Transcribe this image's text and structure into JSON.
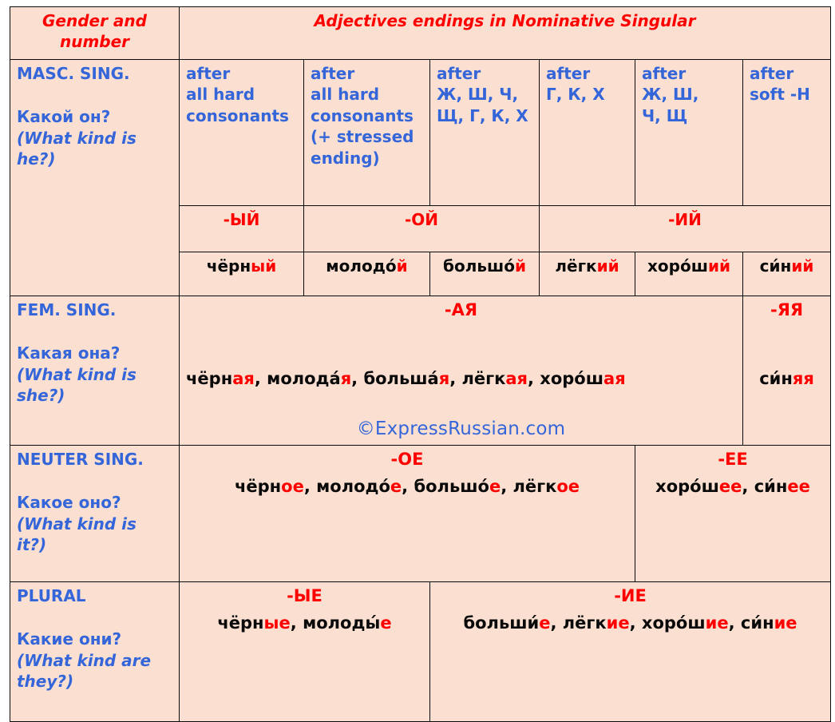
{
  "table": {
    "header": {
      "col1": "Gender and number",
      "col1_line1": "Gender and",
      "col1_line2": "number",
      "span": "Adjectives endings in Nominative Singular"
    },
    "colors": {
      "background": "#fbe0d2",
      "border": "#0a0a0a",
      "red": "#ff0000",
      "blue": "#3465d9",
      "black": "#0a0a0a"
    },
    "watermark": "©ExpressRussian.com",
    "rows": [
      {
        "id": "masculine",
        "gender_title": "MASC. SING.",
        "question": "Какой он?",
        "translation": "(What kind is he?)",
        "translation_line1": "(What kind is",
        "translation_line2": "he?)",
        "conditions": [
          {
            "l1": "after",
            "l2": "all hard",
            "l3": "consonants",
            "l4": "",
            "l5": ""
          },
          {
            "l1": "after",
            "l2": "all hard",
            "l3": "consonants",
            "l4": "(+ stressed",
            "l5": "ending)"
          },
          {
            "l1": "after",
            "l2": "Ж, Ш, Ч,",
            "l3": "Щ, Г, К, Х",
            "l4": "",
            "l5": ""
          },
          {
            "l1": "after",
            "l2": "Г, К, Х",
            "l3": "",
            "l4": "",
            "l5": ""
          },
          {
            "l1": "after",
            "l2": "Ж, Ш,",
            "l3": "Ч, Щ",
            "l4": "",
            "l5": ""
          },
          {
            "l1": "after",
            "l2": "soft -Н",
            "l3": "",
            "l4": "",
            "l5": ""
          }
        ],
        "endings": [
          {
            "label": "-ЫЙ",
            "span": 1
          },
          {
            "label": "-ОЙ",
            "span": 2
          },
          {
            "label": "-ИЙ",
            "span": 3
          }
        ],
        "examples": [
          {
            "stem": "чёрн",
            "end": "ый"
          },
          {
            "stem": "молодо́",
            "end": "й"
          },
          {
            "stem": "большо́",
            "end": "й"
          },
          {
            "stem": "лёгк",
            "end": "ий"
          },
          {
            "stem": "хоро́ш",
            "end": "ий"
          },
          {
            "stem": "си́н",
            "end": "ий"
          }
        ]
      },
      {
        "id": "feminine",
        "gender_title": "FEM. SING.",
        "question": "Какая она?",
        "translation": "(What kind is she?)",
        "translation_line1": "(What kind is",
        "translation_line2": "she?)",
        "main_ending": "-АЯ",
        "main_examples": [
          {
            "stem": "чёрн",
            "end": "ая"
          },
          {
            "stem": "молода́",
            "end": "я"
          },
          {
            "stem": "больша́",
            "end": "я"
          },
          {
            "stem": "лёгк",
            "end": "ая"
          },
          {
            "stem": "хоро́ш",
            "end": "ая"
          }
        ],
        "soft_ending": "-ЯЯ",
        "soft_examples": [
          {
            "stem": "си́н",
            "end": "яя"
          }
        ]
      },
      {
        "id": "neuter",
        "gender_title": "NEUTER SING.",
        "question": "Какое оно?",
        "translation": "(What kind is it?)",
        "translation_line1": "(What kind is",
        "translation_line2": "it?)",
        "main_ending": "-ОЕ",
        "main_examples": [
          {
            "stem": "чёрн",
            "end": "ое"
          },
          {
            "stem": "молодо́",
            "end": "е"
          },
          {
            "stem": "большо́",
            "end": "е"
          },
          {
            "stem": "лёгк",
            "end": "ое"
          }
        ],
        "soft_ending": "-ЕЕ",
        "soft_examples": [
          {
            "stem": "хоро́ш",
            "end": "ее"
          },
          {
            "stem": "си́н",
            "end": "ее"
          }
        ]
      },
      {
        "id": "plural",
        "gender_title": "PLURAL",
        "question": "Какие они?",
        "translation": "(What kind are they?)",
        "translation_line1": "(What kind are",
        "translation_line2": "they?)",
        "main_ending": "-ЫЕ",
        "main_examples": [
          {
            "stem": "чёрн",
            "end": "ые"
          },
          {
            "stem": "молоды́",
            "end": "е"
          }
        ],
        "soft_ending": "-ИЕ",
        "soft_examples": [
          {
            "stem": "больши́",
            "end": "е"
          },
          {
            "stem": "лёгк",
            "end": "ие"
          },
          {
            "stem": "хоро́ш",
            "end": "ие"
          },
          {
            "stem": "си́н",
            "end": "ие"
          }
        ]
      }
    ]
  }
}
